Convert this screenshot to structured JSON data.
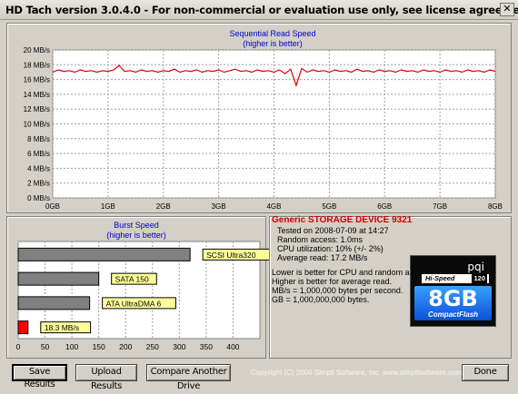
{
  "window": {
    "title": "HD Tach version 3.0.4.0  - For non-commercial or evaluation use only, see license agreement.",
    "close_glyph": "✕"
  },
  "chart_data": [
    {
      "type": "line",
      "title": "Sequential Read Speed",
      "subtitle": "(higher is better)",
      "y_ticks": [
        "0 MB/s",
        "2 MB/s",
        "4 MB/s",
        "6 MB/s",
        "8 MB/s",
        "10 MB/s",
        "12 MB/s",
        "14 MB/s",
        "16 MB/s",
        "18 MB/s",
        "20 MB/s"
      ],
      "x_ticks": [
        "0GB",
        "1GB",
        "2GB",
        "3GB",
        "4GB",
        "5GB",
        "6GB",
        "7GB",
        "8GB"
      ],
      "xlim": [
        0,
        8
      ],
      "ylim": [
        0,
        20
      ],
      "grid": true,
      "line_color": "#e00000",
      "series": [
        {
          "x": [
            0,
            0.1,
            0.2,
            0.3,
            0.4,
            0.5,
            0.6,
            0.7,
            0.8,
            0.9,
            1.0,
            1.1,
            1.2,
            1.3,
            1.4,
            1.5,
            1.6,
            1.7,
            1.8,
            1.9,
            2.0,
            2.1,
            2.2,
            2.3,
            2.4,
            2.5,
            2.6,
            2.7,
            2.8,
            2.9,
            3.0,
            3.1,
            3.2,
            3.3,
            3.4,
            3.5,
            3.6,
            3.7,
            3.8,
            3.9,
            4.0,
            4.1,
            4.2,
            4.3,
            4.4,
            4.5,
            4.6,
            4.7,
            4.8,
            4.9,
            5.0,
            5.1,
            5.2,
            5.3,
            5.4,
            5.5,
            5.6,
            5.7,
            5.8,
            5.9,
            6.0,
            6.1,
            6.2,
            6.3,
            6.4,
            6.5,
            6.6,
            6.7,
            6.8,
            6.9,
            7.0,
            7.1,
            7.2,
            7.3,
            7.4,
            7.5,
            7.6,
            7.7,
            7.8,
            7.9,
            8.0
          ],
          "values": [
            17.0,
            17.3,
            17.1,
            17.2,
            17.0,
            17.3,
            17.1,
            17.2,
            17.0,
            17.2,
            17.1,
            17.3,
            17.9,
            17.1,
            17.2,
            17.0,
            17.3,
            17.1,
            17.2,
            17.0,
            17.2,
            17.1,
            17.4,
            17.0,
            17.2,
            17.1,
            17.3,
            17.0,
            17.2,
            17.1,
            17.3,
            17.0,
            17.2,
            17.4,
            17.1,
            17.2,
            17.0,
            17.3,
            17.1,
            17.2,
            17.0,
            17.3,
            16.8,
            17.4,
            15.2,
            17.5,
            17.0,
            17.3,
            17.1,
            17.2,
            17.0,
            17.3,
            17.1,
            17.2,
            17.0,
            17.4,
            17.1,
            17.2,
            17.0,
            17.3,
            17.1,
            17.2,
            17.0,
            17.3,
            17.1,
            17.2,
            17.0,
            17.3,
            17.1,
            17.2,
            17.0,
            17.3,
            17.1,
            17.2,
            17.0,
            17.3,
            17.1,
            17.2,
            17.0,
            17.3,
            17.1
          ]
        }
      ]
    },
    {
      "type": "bar",
      "orientation": "horizontal",
      "title": "Burst Speed",
      "subtitle": "(higher is better)",
      "x_ticks": [
        "0",
        "50",
        "100",
        "150",
        "200",
        "250",
        "300",
        "350",
        "400"
      ],
      "xlim": [
        0,
        450
      ],
      "grid": true,
      "bars": [
        {
          "label": "SCSI Ultra320",
          "value": 320,
          "color": "#808080"
        },
        {
          "label": "SATA 150",
          "value": 150,
          "color": "#808080"
        },
        {
          "label": "ATA UltraDMA 6",
          "value": 133,
          "color": "#808080"
        },
        {
          "label": "18.3 MB/s",
          "value": 18.3,
          "color": "#ff0000"
        }
      ],
      "tag_color": "#ffff99"
    }
  ],
  "device": {
    "name": "Generic STORAGE DEVICE 9321",
    "tested": "Tested on 2008-07-09 at 14:27",
    "random_access": "Random access: 1.0ms",
    "cpu": "CPU utilization: 10% (+/- 2%)",
    "avg_read": "Average read: 17.2 MB/s"
  },
  "notes": [
    "Lower is better for CPU and random access.",
    "Higher is better for average read.",
    "MB/s = 1,000,000 bytes per second.",
    "GB = 1,000,000,000 bytes."
  ],
  "card": {
    "brand": "pqi",
    "hispeed": "Hi-Speed",
    "speed": "120",
    "size": "8GB",
    "type": "CompactFlash"
  },
  "buttons": {
    "save": "Save Results",
    "upload": "Upload Results",
    "compare": "Compare Another Drive",
    "done": "Done"
  },
  "footer": {
    "copyright": "Copyright (C) 2004 Simpli Software, Inc. www.simplisoftware.com"
  }
}
